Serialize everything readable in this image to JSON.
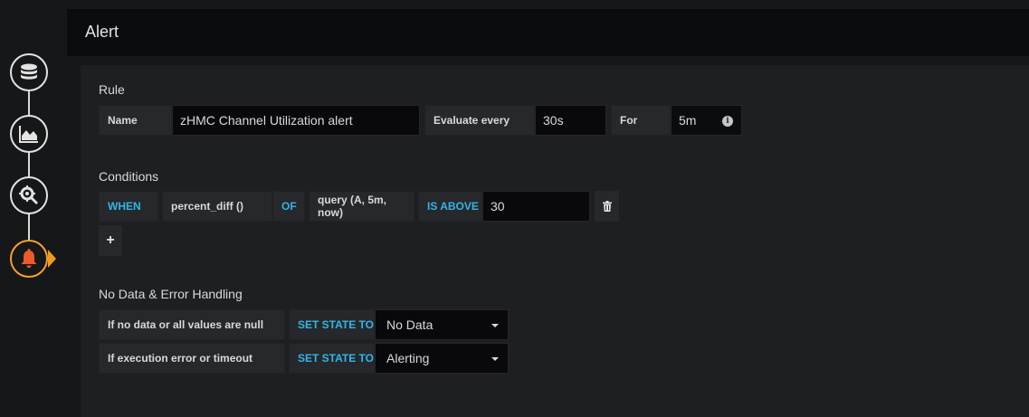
{
  "header": {
    "title": "Alert"
  },
  "sidenav": {
    "items": [
      {
        "name": "queries",
        "icon": "database-icon"
      },
      {
        "name": "visualization",
        "icon": "area-chart-icon"
      },
      {
        "name": "general",
        "icon": "gear-wrench-icon"
      },
      {
        "name": "alert",
        "icon": "bell-icon",
        "active": true
      }
    ]
  },
  "rule": {
    "section_title": "Rule",
    "name_label": "Name",
    "name_value": "zHMC Channel Utilization alert",
    "evaluate_label": "Evaluate every",
    "evaluate_value": "30s",
    "for_label": "For",
    "for_value": "5m",
    "info_glyph": "i"
  },
  "conditions": {
    "section_title": "Conditions",
    "when": "WHEN",
    "reducer": "percent_diff ()",
    "of": "OF",
    "query": "query (A, 5m, now)",
    "evaluator": "IS ABOVE",
    "threshold": "30",
    "add_glyph": "+"
  },
  "no_data": {
    "section_title": "No Data & Error Handling",
    "rows": [
      {
        "label": "If no data or all values are null",
        "set_state": "SET STATE TO",
        "value": "No Data"
      },
      {
        "label": "If execution error or timeout",
        "set_state": "SET STATE TO",
        "value": "Alerting"
      }
    ]
  },
  "colors": {
    "accent_blue": "#33b5e5",
    "active_orange": "#f29a1d",
    "bell_orange": "#eb5a2a"
  }
}
